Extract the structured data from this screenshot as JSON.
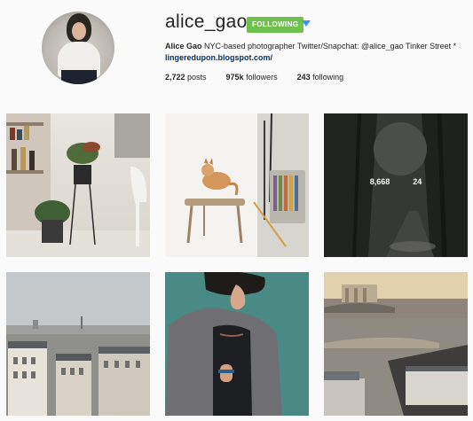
{
  "profile": {
    "username": "alice_gao",
    "follow_label": "FOLLOWING",
    "dropdown_icon": "triangle-down-icon",
    "bio_name": "Alice Gao",
    "bio_text": " NYC-based photographer Twitter/Snapchat: @alice_gao Tinker Street *",
    "bio_link": "lingeredupon.blogspot.com/",
    "stats": {
      "posts_value": "2,722",
      "posts_label": " posts",
      "followers_value": "975k",
      "followers_label": " followers",
      "following_value": "243",
      "following_label": " following"
    }
  },
  "grid": {
    "hovered_tile": {
      "likes": "8,668",
      "comments": "24"
    }
  },
  "colors": {
    "follow_button": "#70c050",
    "link": "#003569",
    "dropdown": "#3897f0"
  }
}
